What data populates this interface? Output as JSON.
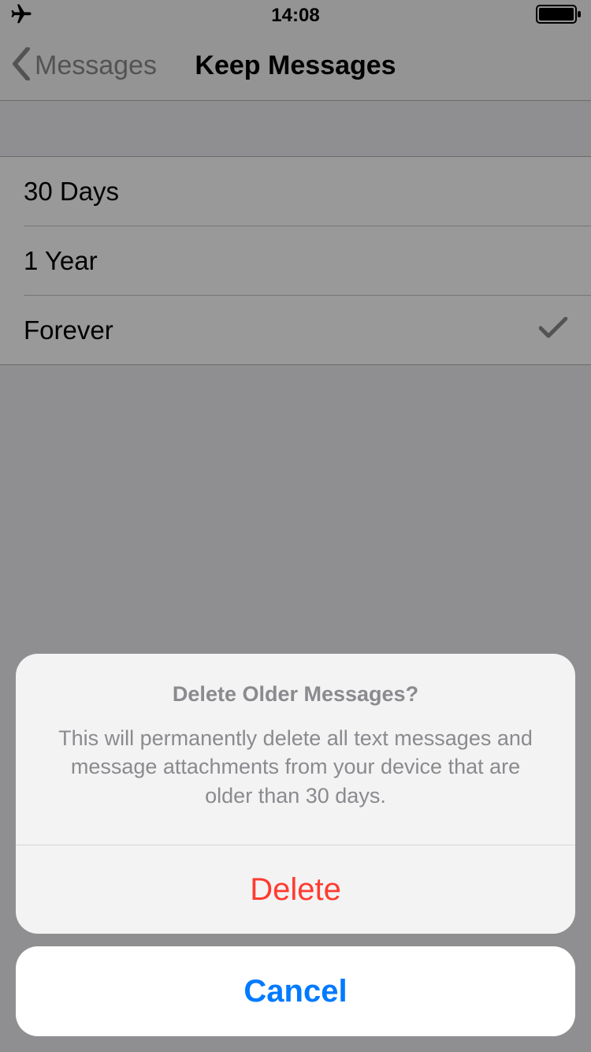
{
  "statusbar": {
    "time": "14:08"
  },
  "nav": {
    "back_label": "Messages",
    "title": "Keep Messages"
  },
  "options": {
    "items": [
      {
        "label": "30 Days",
        "selected": false
      },
      {
        "label": "1 Year",
        "selected": false
      },
      {
        "label": "Forever",
        "selected": true
      }
    ]
  },
  "sheet": {
    "title": "Delete Older Messages?",
    "message": "This will permanently delete all text messages and message attachments from your device that are older than 30 days.",
    "destructive_label": "Delete",
    "cancel_label": "Cancel"
  }
}
